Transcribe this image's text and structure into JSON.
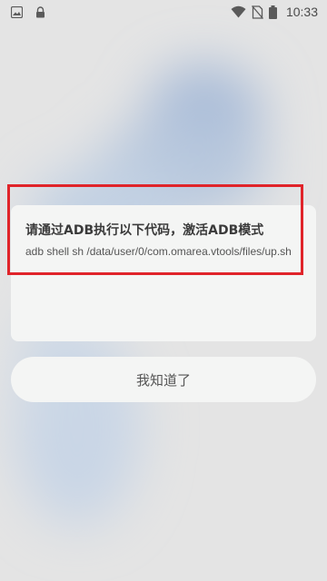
{
  "status_bar": {
    "time": "10:33",
    "left_icons": [
      "gallery-icon",
      "lock-icon"
    ],
    "right_icons": [
      "wifi-icon",
      "no-sim-icon",
      "battery-icon"
    ]
  },
  "dialog": {
    "title": "请通过ADB执行以下代码，激活ADB模式",
    "message": "adb shell sh /data/user/0/com.omarea.vtools/files/up.sh",
    "ok_label": "我知道了",
    "highlight_color": "#e0242a"
  }
}
